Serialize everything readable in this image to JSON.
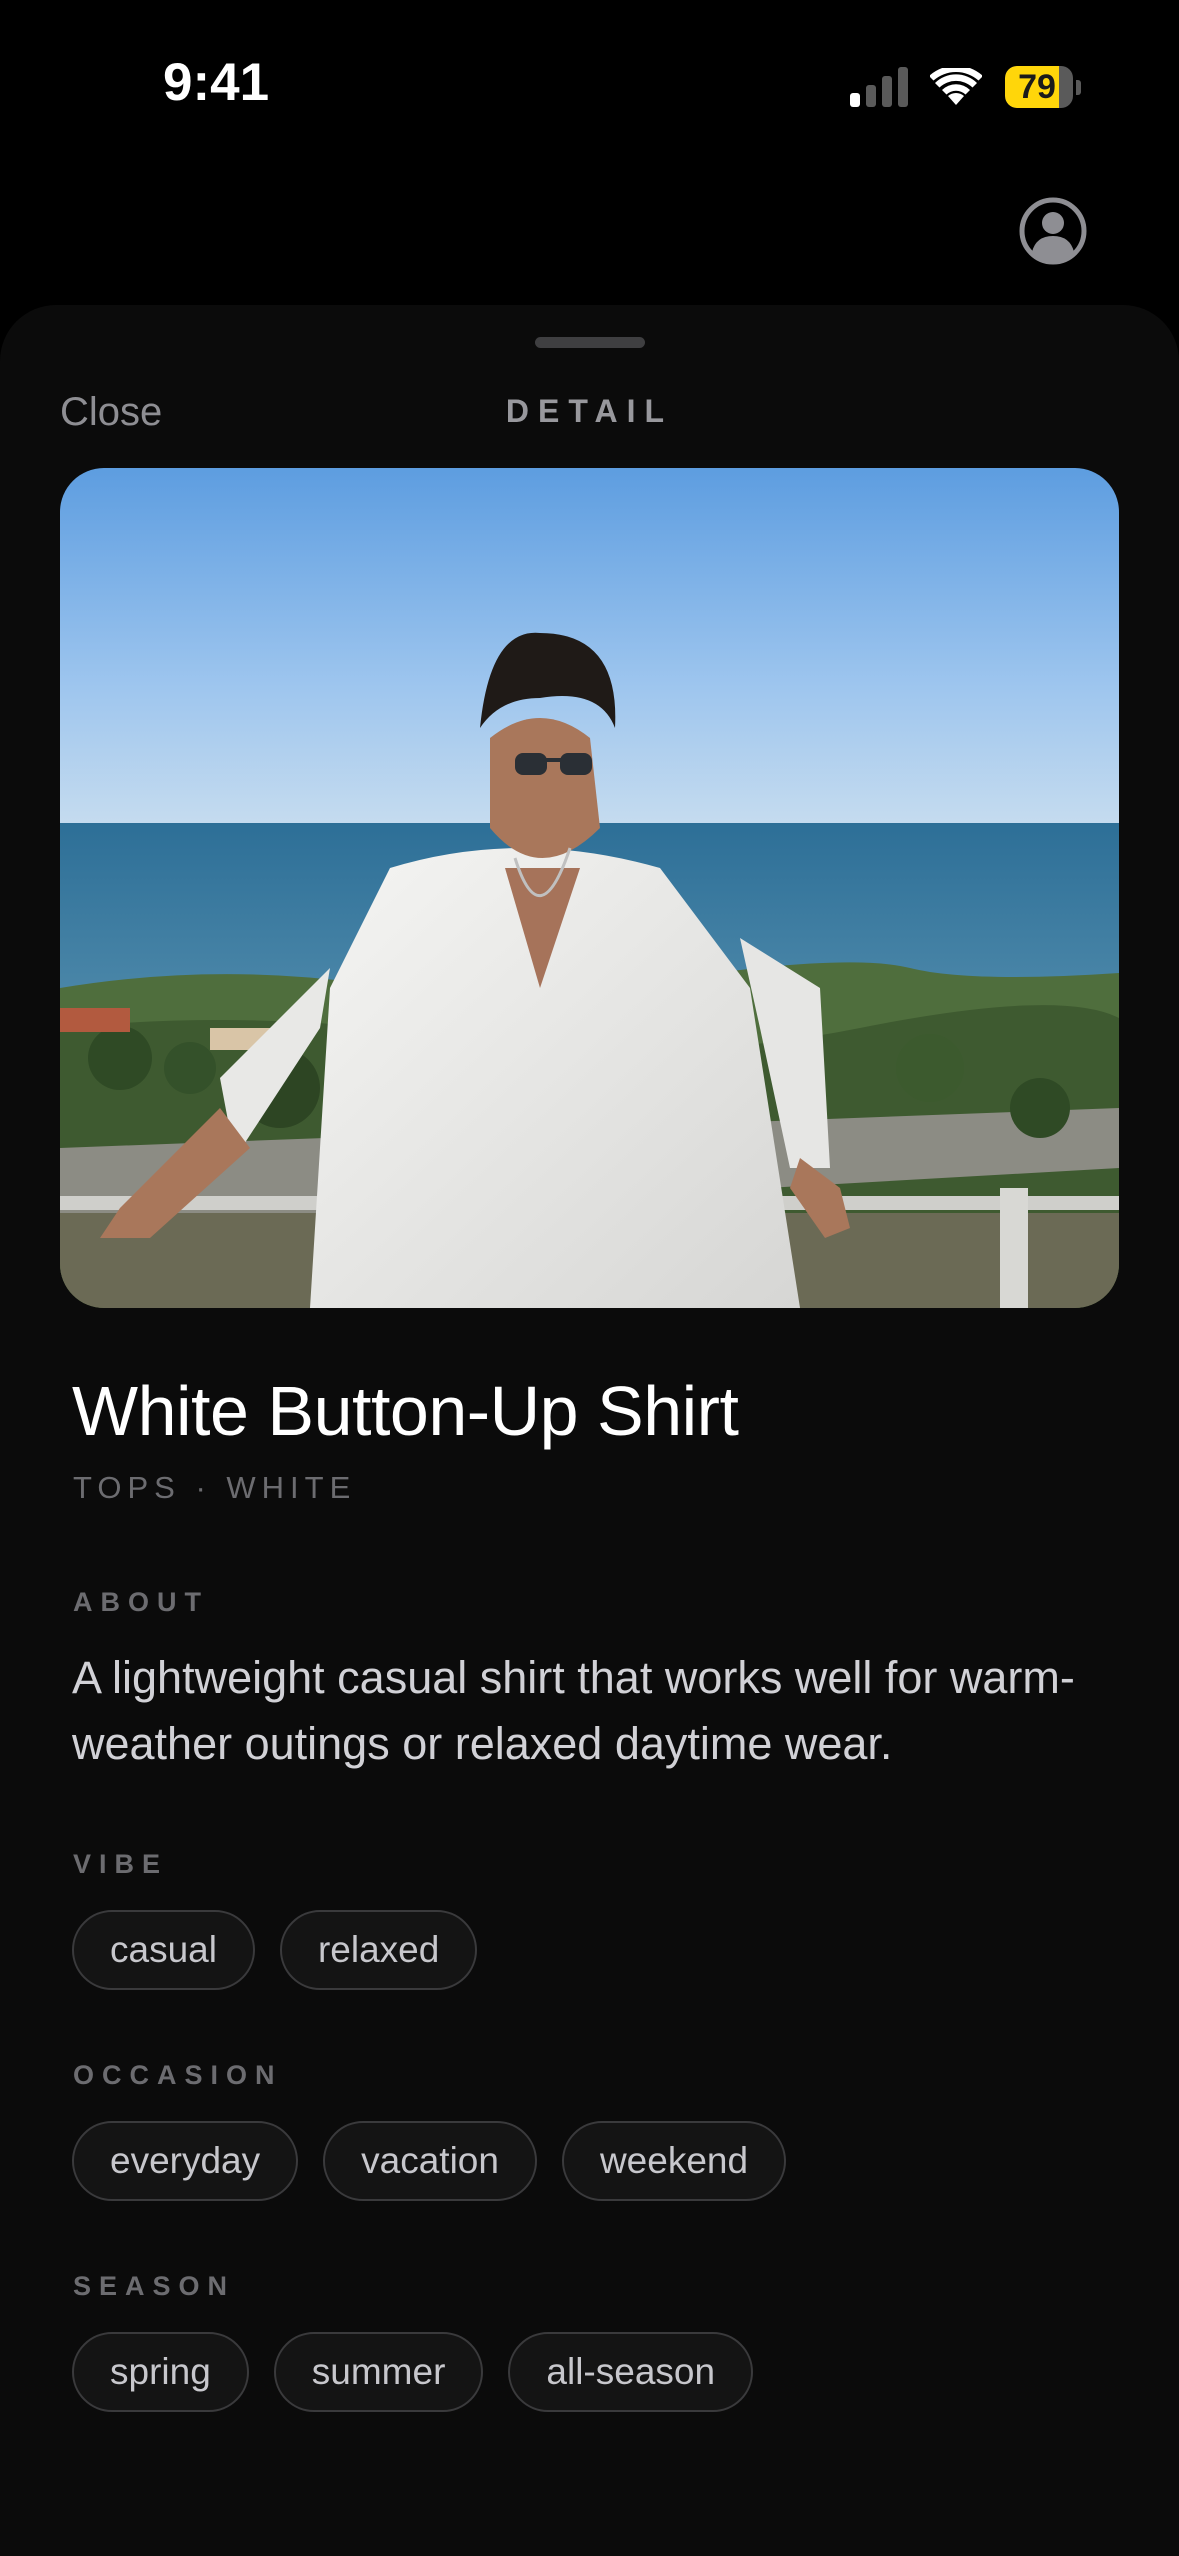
{
  "status_bar": {
    "time": "9:41",
    "battery_level": "79",
    "battery_fraction": 0.79,
    "battery_color": "#ffd60a",
    "signal_bars_active": 1,
    "signal_bars_total": 4,
    "icons": [
      "cellular-signal-icon",
      "wifi-icon",
      "battery-icon"
    ]
  },
  "header": {
    "profile_icon": "person-circle-icon"
  },
  "sheet": {
    "close_label": "Close",
    "title": "DETAIL"
  },
  "item": {
    "name": "White Button-Up Shirt",
    "meta": "TOPS · WHITE",
    "about_label": "ABOUT",
    "about_text": "A lightweight casual shirt that works well for warm-weather outings or relaxed daytime wear.",
    "vibe_label": "VIBE",
    "vibe": [
      "casual",
      "relaxed"
    ],
    "occasion_label": "OCCASION",
    "occasion": [
      "everyday",
      "vacation",
      "weekend"
    ],
    "season_label": "SEASON",
    "season": [
      "spring",
      "summer",
      "all-season"
    ]
  }
}
